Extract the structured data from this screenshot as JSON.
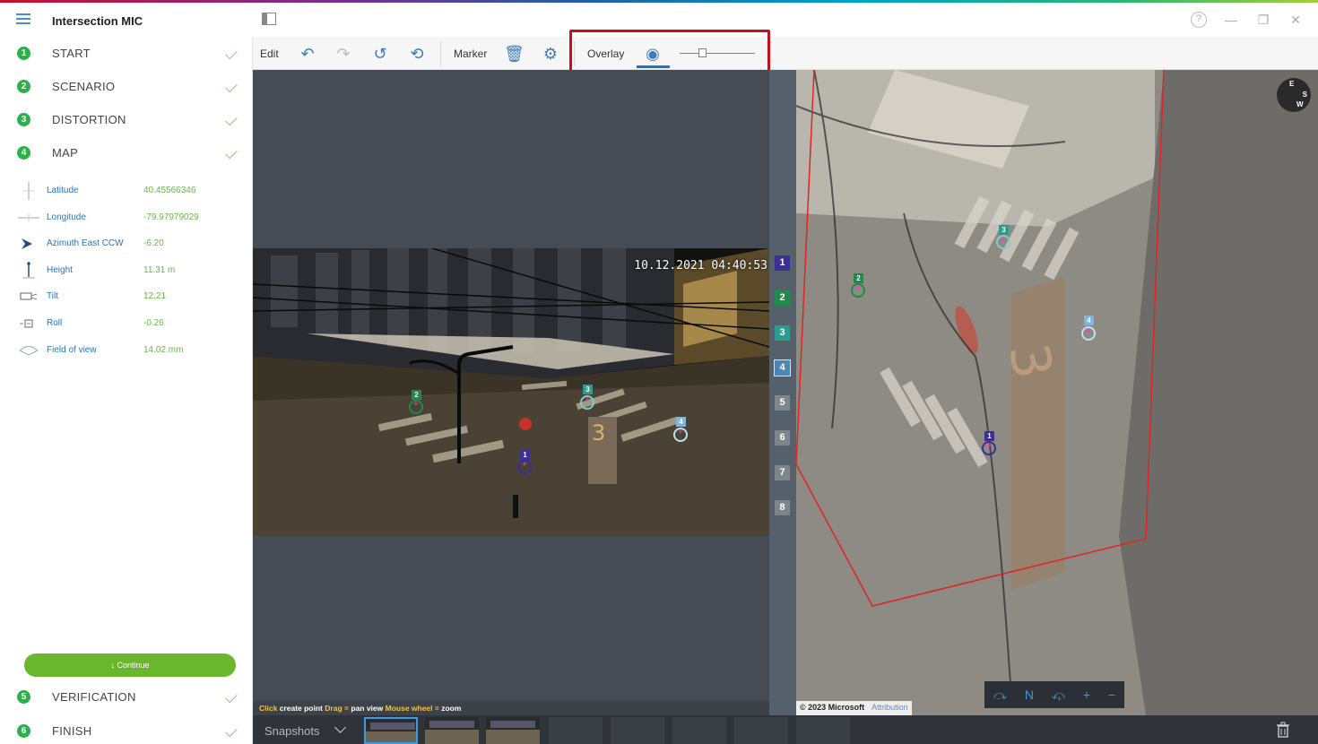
{
  "window": {
    "title": "Intersection MIC"
  },
  "steps": [
    {
      "num": "1",
      "label": "START"
    },
    {
      "num": "2",
      "label": "SCENARIO"
    },
    {
      "num": "3",
      "label": "DISTORTION"
    },
    {
      "num": "4",
      "label": "MAP"
    },
    {
      "num": "5",
      "label": "VERIFICATION"
    },
    {
      "num": "6",
      "label": "FINISH"
    }
  ],
  "params": [
    {
      "name": "Latitude",
      "value": "40.45566346",
      "icon": "latitude-icon"
    },
    {
      "name": "Longitude",
      "value": "-79.97979029",
      "icon": "longitude-icon"
    },
    {
      "name": "Azimuth East CCW",
      "value": "-6.20",
      "icon": "azimuth-icon"
    },
    {
      "name": "Height",
      "value": "11.31 m",
      "icon": "height-icon"
    },
    {
      "name": "Tilt",
      "value": "12.21",
      "icon": "tilt-icon"
    },
    {
      "name": "Roll",
      "value": "-0.26",
      "icon": "roll-icon"
    },
    {
      "name": "Field of view",
      "value": "14.02 mm",
      "icon": "field-of-view-icon"
    }
  ],
  "continue_label": "↓ Continue",
  "toolbar": {
    "edit_label": "Edit",
    "marker_label": "Marker",
    "overlay_label": "Overlay"
  },
  "camera": {
    "timestamp": "10.12.2021 04:40:53",
    "markers": [
      "1",
      "2",
      "3",
      "4"
    ]
  },
  "strip_numbers": [
    "1",
    "2",
    "3",
    "4",
    "5",
    "6",
    "7",
    "8"
  ],
  "map": {
    "compass_labels": {
      "e": "E",
      "s": "S",
      "w": "W"
    },
    "copyright": "© 2023 Microsoft",
    "attribution": "Attribution",
    "controls": [
      "⤼",
      "N",
      "⤽",
      "+",
      "−"
    ]
  },
  "hint": {
    "click_key": "Click",
    "click_action": "create point",
    "drag_key": "Drag =",
    "drag_action": "pan view",
    "wheel_key": "Mouse wheel =",
    "wheel_action": "zoom"
  },
  "snapshots_label": "Snapshots",
  "colors": {
    "marker1": "#3a2f95",
    "marker2": "#1f8a4c",
    "marker3": "#2a9d8f",
    "marker4": "#7fb6df",
    "step_green": "#2bb14a",
    "accent": "#1b77c4"
  }
}
